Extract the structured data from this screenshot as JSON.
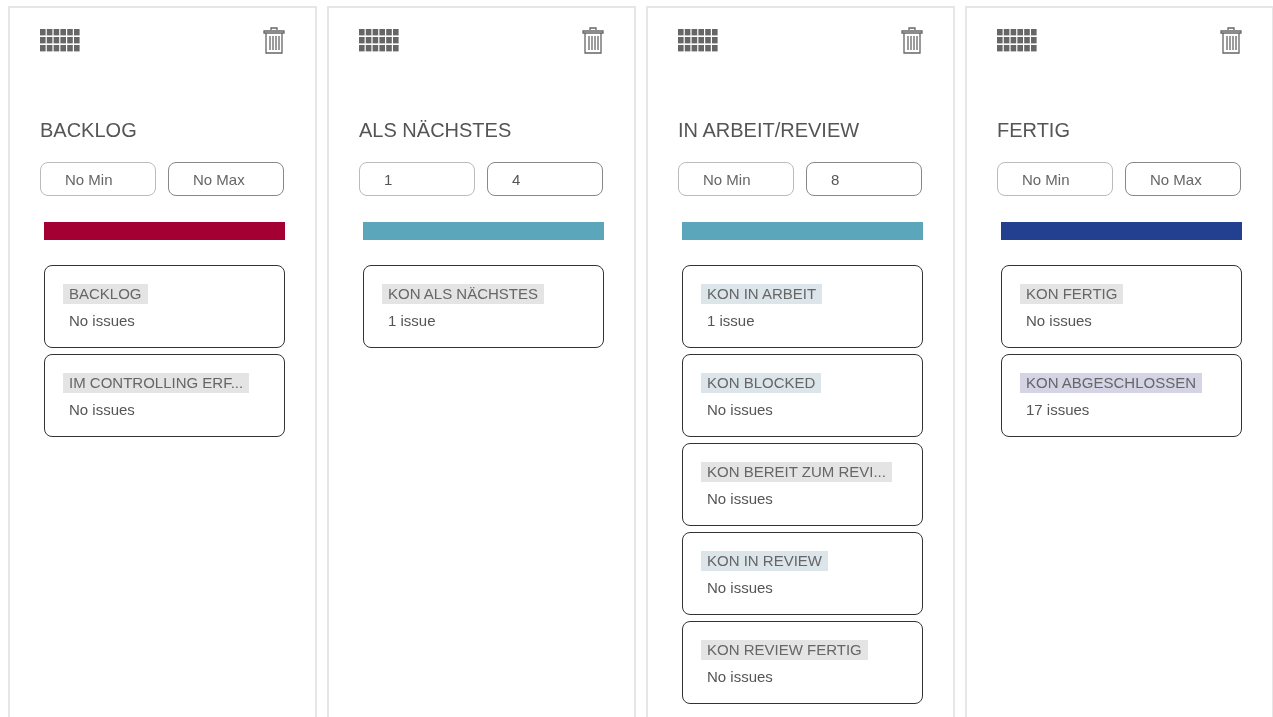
{
  "columns": [
    {
      "title": "BACKLOG",
      "min": {
        "placeholder": "No Min"
      },
      "max": {
        "placeholder": "No Max"
      },
      "color": "#a50034",
      "statuses": [
        {
          "name": "BACKLOG",
          "count": "No issues",
          "color": "#e4e4e4"
        },
        {
          "name": "IM CONTROLLING ERF...",
          "count": "No issues",
          "color": "#e4e4e4"
        }
      ]
    },
    {
      "title": "ALS NÄCHSTES",
      "min": {
        "value": "1"
      },
      "max": {
        "value": "4"
      },
      "color": "#5ba6bb",
      "statuses": [
        {
          "name": "KON ALS NÄCHSTES",
          "count": "1 issue",
          "color": "#e4e4e4"
        }
      ]
    },
    {
      "title": "IN ARBEIT/REVIEW",
      "min": {
        "placeholder": "No Min"
      },
      "max": {
        "value": "8"
      },
      "color": "#5ba6bb",
      "statuses": [
        {
          "name": "KON IN ARBEIT",
          "count": "1 issue",
          "color": "#dbe5ea"
        },
        {
          "name": "KON BLOCKED",
          "count": "No issues",
          "color": "#dbe5ea"
        },
        {
          "name": "KON BEREIT ZUM REVI...",
          "count": "No issues",
          "color": "#e4e4e4"
        },
        {
          "name": "KON IN REVIEW",
          "count": "No issues",
          "color": "#dbe5ea"
        },
        {
          "name": "KON REVIEW FERTIG",
          "count": "No issues",
          "color": "#e4e4e4"
        }
      ]
    },
    {
      "title": "FERTIG",
      "min": {
        "placeholder": "No Min"
      },
      "max": {
        "placeholder": "No Max"
      },
      "color": "#233f8f",
      "statuses": [
        {
          "name": "KON FERTIG",
          "count": "No issues",
          "color": "#e4e4e4"
        },
        {
          "name": "KON ABGESCHLOSSEN",
          "count": "17 issues",
          "color": "#d4d4e6"
        }
      ]
    }
  ]
}
